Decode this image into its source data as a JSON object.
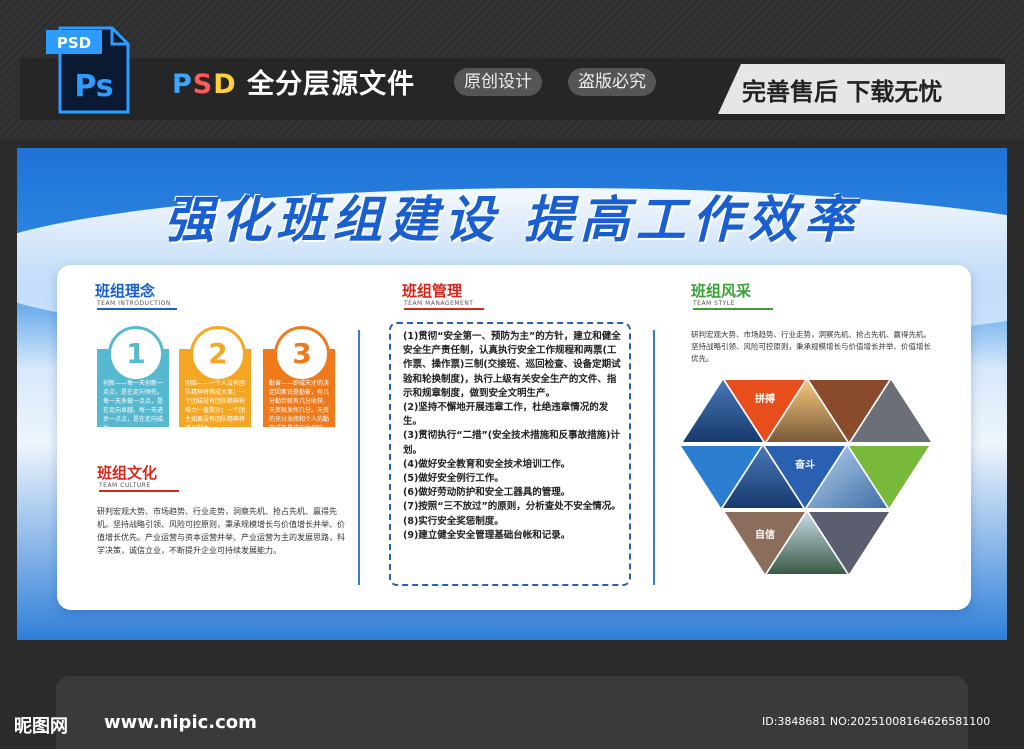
{
  "header": {
    "file_badge": "PSD",
    "ps_label": "Ps",
    "title_psd": [
      "P",
      "S",
      "D"
    ],
    "title_rest": "全分层源文件",
    "tags": [
      "原创设计",
      "盗版必究"
    ],
    "slogan": "完善售后 下载无忧"
  },
  "board": {
    "headline": "强化班组建设  提高工作效率",
    "concept": {
      "title": "班组理念",
      "subtitle": "TEAM INTRODUCTION",
      "cards": [
        {
          "num": "1",
          "color": "#57b9cf",
          "text": "创新——每一天创新一点点，是在走向领先。每一天多做一点点，是在走向卓越。每一天进步一点点，是在走向成功。"
        },
        {
          "num": "2",
          "color": "#f5a623",
          "text": "团结——一个人没有团队精神将难成大事；一个团结没有团队精神将难力一盘散沙；一个团主如果没有团队精神将难以做大。"
        },
        {
          "num": "3",
          "color": "#ef7a1c",
          "text": "勤奋——即成天才的决定因素说是勤奋，有几分勤劳就有几分收获，天资就发挥几分。天资的充分发挥和个人的勤学成熟是成正比例的。"
        }
      ]
    },
    "culture": {
      "title": "班组文化",
      "subtitle": "TEAM CULTURE",
      "text": "研判宏观大势、市场趋势、行业走势，洞察先机、抢占先机、赢得先机。坚持战略引领、风险可控原则，秉承规模增长与价值增长并举、价值增长优先。产业运营与资本运营并举、产业运营为主的发展思路，科学决策，诚信立业，不断提升企业可持续发展能力。"
    },
    "management": {
      "title": "班组管理",
      "subtitle": "TEAM MANAGEMENT",
      "items": [
        "(1)贯彻“安全第一、预防为主”的方针，建立和健全安全生产责任制，认真执行安全工作规程和两票(工作票、操作票)三制(交接班、巡回检查、设备定期试验和轮换制度)，执行上级有关安全生产的文件、指示和规章制度，做到安全文明生产。",
        "(2)坚持不懈地开展违章工作，杜绝违章情况的发生。",
        "(3)贯彻执行“二措”(安全技术措施和反事故措施)计划。",
        "(4)做好安全教育和安全技术培训工作。",
        "(5)做好安全例行工作。",
        "(6)做好劳动防护和安全工器具的管理。",
        "(7)按照“三不放过”的原则，分析查处不安全情况。",
        "(8)实行安全奖惩制度。",
        "(9)建立健全安全管理基础台帐和记录。"
      ]
    },
    "style": {
      "title": "班组风采",
      "subtitle": "TEAM STYLE",
      "text": "研判宏观大势、市场趋势、行业走势，洞察先机、抢占先机、赢得先机。坚持战略引领、风险可控原则，秉承规模增长与价值增长并举、价值增长优先。",
      "labels": [
        "拼搏",
        "奋斗",
        "自信"
      ]
    }
  },
  "footer": {
    "logo": "昵图网",
    "url": "www.nipic.com",
    "id": "ID:3848681 NO:20251008164626581100"
  },
  "colors": {
    "brand_blue": "#1a5fd0",
    "concept_title": "#1a5fd0",
    "culture_title": "#d9261c",
    "mgmt_title": "#d9261c",
    "style_title": "#3aa135"
  }
}
